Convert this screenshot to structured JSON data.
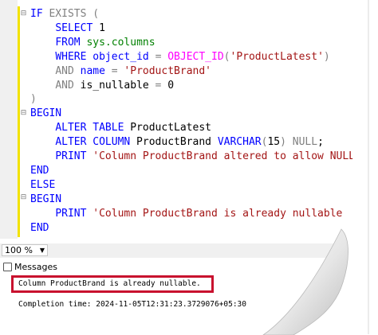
{
  "code_lines": [
    "IF EXISTS (",
    "    SELECT 1",
    "    FROM sys.columns",
    "    WHERE object_id = OBJECT_ID('ProductLatest')",
    "    AND name = 'ProductBrand'",
    "    AND is_nullable = 0",
    ")",
    "BEGIN",
    "    ALTER TABLE ProductLatest",
    "    ALTER COLUMN ProductBrand VARCHAR(15) NULL;",
    "    PRINT 'Column ProductBrand altered to allow NULL.';",
    "END",
    "ELSE",
    "BEGIN",
    "    PRINT 'Column ProductBrand is already nullable.';",
    "END"
  ],
  "status_bar": {
    "zoom_value": "100 %"
  },
  "results_tab": {
    "label": "Messages"
  },
  "messages": {
    "line1": "Column ProductBrand is already nullable.",
    "line2": "Completion time: 2024-11-05T12:31:23.3729076+05:30"
  },
  "colors": {
    "keyword": "#0000ff",
    "string": "#a31515",
    "function": "#ff00ff",
    "gray": "#808080",
    "highlight_border": "#c8102e",
    "change_bar": "#f2e200"
  }
}
